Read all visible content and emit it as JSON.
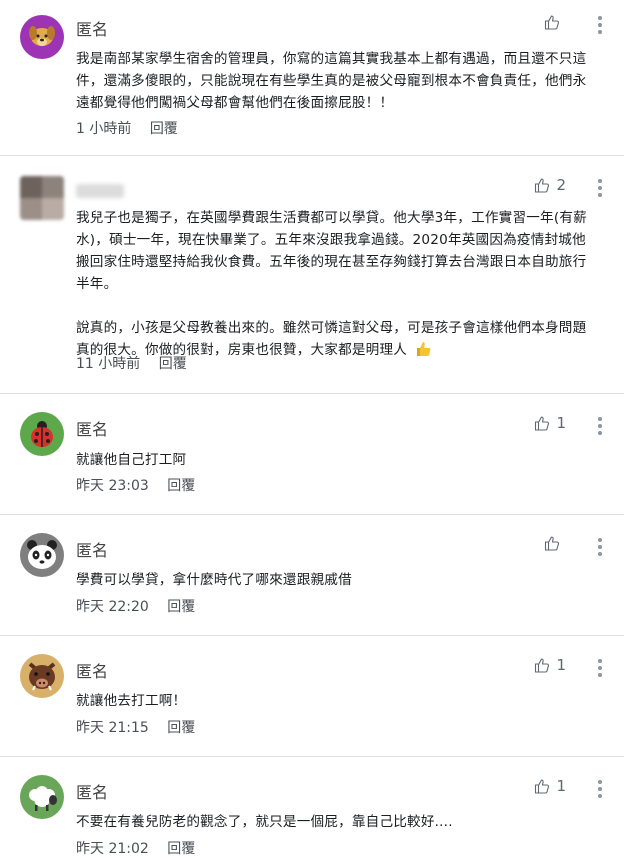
{
  "comments": [
    {
      "author": "匿名",
      "avatar": "dog-icon",
      "paragraphs": [
        "我是南部某家學生宿舍的管理員，你寫的這篇其實我基本上都有遇過，而且還不只這件，還滿多傻眼的，只能說現在有些學生真的是被父母寵到根本不會負責任，他們永遠都覺得他們闖禍父母都會幫他們在後面擦屁股！！"
      ],
      "time": "1 小時前",
      "reply": "回覆",
      "likes": ""
    },
    {
      "author": "",
      "avatar": "blurred-avatar",
      "paragraphs": [
        "我兒子也是獨子，在英國學費跟生活費都可以學貸。他大學3年，工作實習一年(有薪水)，碩士一年，現在快畢業了。五年來沒跟我拿過錢。2020年英國因為疫情封城他搬回家住時還堅持給我伙食費。五年後的現在甚至存夠錢打算去台灣跟日本自助旅行半年。",
        "說真的，小孩是父母教養出來的。雖然可憐這對父母，可是孩子會這樣他們本身問題真的很大。你做的很對，房東也很贊，大家都是明理人"
      ],
      "time": "11 小時前",
      "reply": "回覆",
      "likes": "2"
    },
    {
      "author": "匿名",
      "avatar": "ladybug-icon",
      "paragraphs": [
        "就讓他自己打工阿"
      ],
      "time": "昨天 23:03",
      "reply": "回覆",
      "likes": "1"
    },
    {
      "author": "匿名",
      "avatar": "panda-icon",
      "paragraphs": [
        "學費可以學貸，拿什麼時代了哪來還跟親戚借"
      ],
      "time": "昨天 22:20",
      "reply": "回覆",
      "likes": ""
    },
    {
      "author": "匿名",
      "avatar": "boar-icon",
      "paragraphs": [
        "就讓他去打工啊！"
      ],
      "time": "昨天 21:15",
      "reply": "回覆",
      "likes": "1"
    },
    {
      "author": "匿名",
      "avatar": "sheep-icon",
      "paragraphs": [
        "不要在有養兒防老的觀念了，就只是一個屁，靠自己比較好...."
      ],
      "time": "昨天 21:02",
      "reply": "回覆",
      "likes": "1"
    }
  ],
  "colors": {
    "dog_bg": "#9c34b3",
    "ladybug_bg": "#5da84b",
    "panda_bg": "#7f7f7f",
    "boar_bg": "#d8b06a",
    "sheep_bg": "#6aa65a",
    "like_icon": "#606770",
    "thumb_emoji": "#f7c331"
  }
}
